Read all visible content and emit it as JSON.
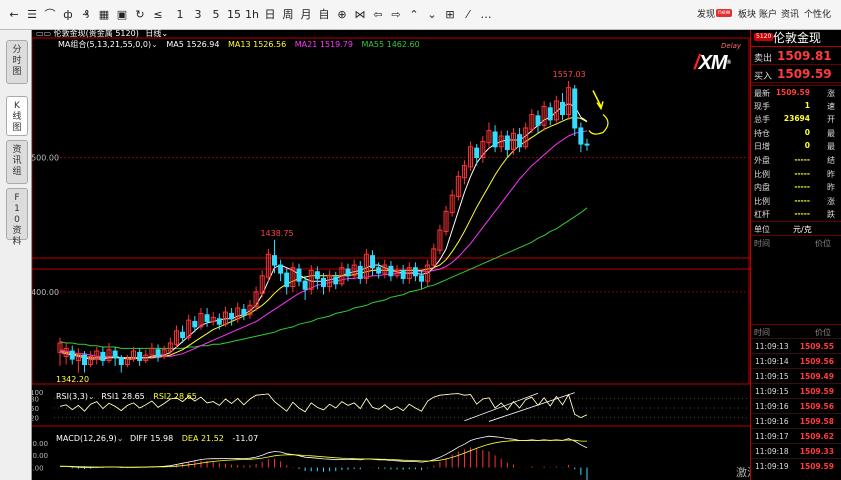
{
  "toolbar": {
    "icons": [
      {
        "name": "back-arrow-icon",
        "glyph": "←"
      },
      {
        "name": "list-icon",
        "glyph": "☰"
      },
      {
        "name": "line-chart-icon",
        "glyph": "⌒"
      },
      {
        "name": "bar-chart-icon",
        "glyph": "ф"
      },
      {
        "name": "candle-chart-icon",
        "glyph": "₰"
      },
      {
        "name": "table-icon",
        "glyph": "▦"
      },
      {
        "name": "panel-icon",
        "glyph": "▣"
      },
      {
        "name": "refresh-icon",
        "glyph": "↻"
      },
      {
        "name": "draw-line-icon",
        "glyph": "≤"
      }
    ],
    "periods": [
      "1",
      "3",
      "5",
      "15",
      "1h",
      "日",
      "周",
      "月",
      "自"
    ],
    "nav_icons": [
      {
        "name": "zoom-in-icon",
        "glyph": "⊕"
      },
      {
        "name": "zoom-fit-icon",
        "glyph": "⋈"
      },
      {
        "name": "scroll-left-icon",
        "glyph": "⇦"
      },
      {
        "name": "scroll-right-icon",
        "glyph": "⇨"
      },
      {
        "name": "expand-up-icon",
        "glyph": "⌃"
      },
      {
        "name": "collapse-down-icon",
        "glyph": "⌄"
      },
      {
        "name": "layout-icon",
        "glyph": "⊞"
      },
      {
        "name": "pen-icon",
        "glyph": "⁄"
      },
      {
        "name": "more-icon",
        "glyph": "…"
      }
    ],
    "discover": "发现",
    "new_badge": "new",
    "sector": "板块",
    "account": "账户",
    "news": "资讯",
    "personalize": "个性化"
  },
  "left_tabs": [
    "分时图",
    "K线图",
    "资讯组",
    "F10资料"
  ],
  "chart": {
    "header": {
      "title": "伦敦金现(贵金属 5120)",
      "period": "日线"
    },
    "ma_legend": {
      "label": "MA组合(5,13,21,55,0,0)",
      "ma5": "MA5 1526.94",
      "ma13": "MA13 1526.56",
      "ma21": "MA21 1519.79",
      "ma55": "MA55 1462.60"
    },
    "price_labels": {
      "high": "1557.03",
      "mid_high": "1438.75",
      "low": "1342.20",
      "grid1": "1500.00",
      "grid2": "1400.00"
    },
    "delay": "Delay",
    "rsi": {
      "label": "RSI(3,3)",
      "rsi1": "RSI1 28.65",
      "rsi2": "RSI2 28.65",
      "levels": [
        "100",
        "80",
        "50",
        "20"
      ]
    },
    "macd": {
      "label": "MACD(12,26,9)",
      "diff": "DIFF 15.98",
      "dea": "DEA 21.52",
      "macd": "-11.07",
      "levels": [
        "20.00",
        "10.00",
        "0.00"
      ]
    },
    "watermark": "激活 Windows",
    "colors": {
      "up": "#ff3333",
      "down": "#33ddff",
      "ma5": "#ffffff",
      "ma13": "#ffff33",
      "ma21": "#ff33ff",
      "ma55": "#33cc33"
    }
  },
  "chart_data": {
    "type": "candlestick",
    "title": "伦敦金现",
    "ylim": [
      1330,
      1580
    ],
    "candles": [
      [
        1355,
        1362,
        1348,
        1345,
        1366
      ],
      [
        1352,
        1358,
        1348,
        1346,
        1362
      ],
      [
        1356,
        1350,
        1346,
        1348,
        1360
      ],
      [
        1349,
        1354,
        1344,
        1340,
        1358
      ],
      [
        1353,
        1346,
        1342,
        1340,
        1356
      ],
      [
        1346,
        1352,
        1346,
        1344,
        1356
      ],
      [
        1350,
        1356,
        1350,
        1346,
        1359
      ],
      [
        1355,
        1349,
        1347,
        1345,
        1359
      ],
      [
        1349,
        1357,
        1349,
        1347,
        1362
      ],
      [
        1356,
        1351,
        1349,
        1345,
        1359
      ],
      [
        1351,
        1346,
        1343,
        1340,
        1353
      ],
      [
        1346,
        1350,
        1346,
        1344,
        1353
      ],
      [
        1350,
        1356,
        1350,
        1348,
        1359
      ],
      [
        1355,
        1349,
        1347,
        1345,
        1358
      ],
      [
        1349,
        1353,
        1349,
        1347,
        1357
      ],
      [
        1353,
        1358,
        1353,
        1350,
        1362
      ],
      [
        1357,
        1352,
        1350,
        1348,
        1361
      ],
      [
        1352,
        1357,
        1352,
        1350,
        1360
      ],
      [
        1356,
        1362,
        1356,
        1353,
        1366
      ],
      [
        1361,
        1371,
        1361,
        1358,
        1375
      ],
      [
        1370,
        1366,
        1364,
        1362,
        1375
      ],
      [
        1366,
        1379,
        1366,
        1364,
        1383
      ],
      [
        1378,
        1374,
        1372,
        1370,
        1382
      ],
      [
        1374,
        1384,
        1374,
        1372,
        1388
      ],
      [
        1383,
        1378,
        1376,
        1374,
        1388
      ],
      [
        1378,
        1381,
        1378,
        1375,
        1385
      ],
      [
        1380,
        1376,
        1374,
        1372,
        1384
      ],
      [
        1376,
        1385,
        1376,
        1374,
        1389
      ],
      [
        1384,
        1380,
        1378,
        1375,
        1388
      ],
      [
        1380,
        1388,
        1380,
        1377,
        1392
      ],
      [
        1387,
        1383,
        1381,
        1379,
        1391
      ],
      [
        1383,
        1390,
        1383,
        1380,
        1394
      ],
      [
        1389,
        1400,
        1389,
        1386,
        1404
      ],
      [
        1399,
        1412,
        1399,
        1396,
        1416
      ],
      [
        1411,
        1428,
        1411,
        1408,
        1432
      ],
      [
        1427,
        1420,
        1416,
        1414,
        1438.75
      ],
      [
        1420,
        1414,
        1412,
        1408,
        1424
      ],
      [
        1414,
        1404,
        1402,
        1398,
        1418
      ],
      [
        1404,
        1418,
        1404,
        1400,
        1422
      ],
      [
        1417,
        1408,
        1406,
        1404,
        1421
      ],
      [
        1408,
        1402,
        1396,
        1394,
        1412
      ],
      [
        1402,
        1416,
        1402,
        1398,
        1420
      ],
      [
        1415,
        1410,
        1406,
        1402,
        1419
      ],
      [
        1410,
        1404,
        1400,
        1398,
        1414
      ],
      [
        1404,
        1412,
        1404,
        1400,
        1416
      ],
      [
        1411,
        1406,
        1404,
        1402,
        1415
      ],
      [
        1406,
        1418,
        1406,
        1404,
        1422
      ],
      [
        1417,
        1412,
        1410,
        1408,
        1421
      ],
      [
        1412,
        1420,
        1412,
        1410,
        1424
      ],
      [
        1419,
        1410,
        1408,
        1406,
        1423
      ],
      [
        1410,
        1428,
        1410,
        1406,
        1432
      ],
      [
        1427,
        1418,
        1416,
        1412,
        1431
      ],
      [
        1418,
        1414,
        1412,
        1410,
        1422
      ],
      [
        1414,
        1420,
        1414,
        1410,
        1424
      ],
      [
        1419,
        1412,
        1410,
        1408,
        1423
      ],
      [
        1412,
        1416,
        1412,
        1410,
        1420
      ],
      [
        1416,
        1410,
        1408,
        1406,
        1420
      ],
      [
        1410,
        1418,
        1410,
        1406,
        1422
      ],
      [
        1418,
        1412,
        1410,
        1408,
        1422
      ],
      [
        1412,
        1408,
        1406,
        1402,
        1416
      ],
      [
        1408,
        1420,
        1408,
        1404,
        1424
      ],
      [
        1420,
        1432,
        1420,
        1418,
        1436
      ],
      [
        1431,
        1446,
        1431,
        1428,
        1450
      ],
      [
        1445,
        1460,
        1445,
        1442,
        1464
      ],
      [
        1459,
        1472,
        1459,
        1456,
        1476
      ],
      [
        1471,
        1486,
        1471,
        1468,
        1490
      ],
      [
        1485,
        1494,
        1485,
        1480,
        1498
      ],
      [
        1493,
        1508,
        1493,
        1490,
        1512
      ],
      [
        1507,
        1500,
        1496,
        1494,
        1510
      ],
      [
        1500,
        1512,
        1500,
        1496,
        1516
      ],
      [
        1511,
        1520,
        1511,
        1508,
        1526
      ],
      [
        1519,
        1508,
        1506,
        1504,
        1524
      ],
      [
        1508,
        1516,
        1508,
        1504,
        1520
      ],
      [
        1516,
        1506,
        1504,
        1500,
        1520
      ],
      [
        1506,
        1518,
        1506,
        1502,
        1522
      ],
      [
        1517,
        1508,
        1506,
        1504,
        1522
      ],
      [
        1508,
        1522,
        1508,
        1506,
        1526
      ],
      [
        1521,
        1532,
        1521,
        1518,
        1536
      ],
      [
        1531,
        1524,
        1522,
        1518,
        1535
      ],
      [
        1524,
        1538,
        1524,
        1520,
        1542
      ],
      [
        1537,
        1528,
        1526,
        1524,
        1541
      ],
      [
        1528,
        1542,
        1528,
        1526,
        1546
      ],
      [
        1541,
        1532,
        1530,
        1528,
        1548
      ],
      [
        1532,
        1552,
        1532,
        1528,
        1557.03
      ],
      [
        1551,
        1522,
        1520,
        1516,
        1554
      ],
      [
        1522,
        1510,
        1508,
        1504,
        1526
      ],
      [
        1510,
        1509.59,
        1507,
        1505,
        1514
      ]
    ],
    "ma5": [
      1355,
      1354,
      1353,
      1352,
      1351,
      1350,
      1350,
      1350,
      1351,
      1352,
      1351,
      1350,
      1350,
      1351,
      1351,
      1352,
      1353,
      1353,
      1355,
      1359,
      1363,
      1367,
      1371,
      1375,
      1377,
      1378,
      1379,
      1380,
      1380,
      1382,
      1383,
      1386,
      1390,
      1398,
      1408,
      1418,
      1420,
      1418,
      1416,
      1413,
      1410,
      1408,
      1408,
      1408,
      1409,
      1410,
      1412,
      1414,
      1415,
      1416,
      1418,
      1420,
      1420,
      1418,
      1416,
      1415,
      1414,
      1414,
      1414,
      1413,
      1414,
      1418,
      1424,
      1432,
      1446,
      1460,
      1474,
      1486,
      1496,
      1502,
      1507,
      1510,
      1512,
      1513,
      1513,
      1513,
      1516,
      1520,
      1524,
      1528,
      1530,
      1534,
      1538,
      1540,
      1538,
      1530,
      1526.94
    ],
    "ma13": [
      1356,
      1355,
      1354,
      1353,
      1352,
      1351,
      1351,
      1351,
      1351,
      1351,
      1351,
      1351,
      1351,
      1351,
      1351,
      1351,
      1352,
      1352,
      1353,
      1355,
      1357,
      1360,
      1363,
      1366,
      1369,
      1372,
      1374,
      1376,
      1378,
      1380,
      1382,
      1384,
      1387,
      1390,
      1394,
      1399,
      1403,
      1406,
      1408,
      1410,
      1411,
      1412,
      1412,
      1412,
      1412,
      1412,
      1412,
      1412,
      1413,
      1414,
      1415,
      1416,
      1416,
      1416,
      1416,
      1416,
      1416,
      1416,
      1416,
      1416,
      1417,
      1418,
      1420,
      1424,
      1430,
      1437,
      1445,
      1454,
      1463,
      1471,
      1479,
      1487,
      1494,
      1500,
      1505,
      1509,
      1512,
      1515,
      1518,
      1521,
      1523,
      1525,
      1527,
      1529,
      1530,
      1529,
      1526.56
    ],
    "ma21": [
      1357,
      1356,
      1355,
      1354,
      1354,
      1353,
      1352,
      1352,
      1352,
      1351,
      1351,
      1351,
      1351,
      1351,
      1351,
      1351,
      1351,
      1352,
      1352,
      1353,
      1354,
      1356,
      1358,
      1360,
      1362,
      1364,
      1366,
      1368,
      1370,
      1372,
      1374,
      1376,
      1378,
      1381,
      1384,
      1387,
      1390,
      1393,
      1396,
      1399,
      1401,
      1403,
      1405,
      1406,
      1407,
      1408,
      1409,
      1410,
      1410,
      1411,
      1411,
      1412,
      1412,
      1413,
      1413,
      1414,
      1414,
      1414,
      1415,
      1415,
      1415,
      1416,
      1417,
      1419,
      1422,
      1426,
      1431,
      1436,
      1442,
      1448,
      1454,
      1460,
      1466,
      1472,
      1478,
      1484,
      1489,
      1494,
      1498,
      1502,
      1506,
      1510,
      1513,
      1516,
      1518,
      1519,
      1519.79
    ],
    "ma55": [
      1363,
      1362,
      1362,
      1361,
      1361,
      1360,
      1360,
      1359,
      1359,
      1359,
      1358,
      1358,
      1358,
      1358,
      1358,
      1358,
      1358,
      1358,
      1358,
      1358,
      1358,
      1359,
      1359,
      1360,
      1360,
      1361,
      1361,
      1362,
      1363,
      1364,
      1365,
      1366,
      1367,
      1368,
      1369,
      1370,
      1372,
      1373,
      1374,
      1376,
      1377,
      1378,
      1380,
      1381,
      1382,
      1384,
      1385,
      1386,
      1388,
      1389,
      1390,
      1392,
      1393,
      1394,
      1396,
      1397,
      1398,
      1400,
      1401,
      1402,
      1404,
      1405,
      1407,
      1409,
      1411,
      1413,
      1415,
      1417,
      1419,
      1421,
      1423,
      1425,
      1427,
      1429,
      1431,
      1433,
      1435,
      1437,
      1440,
      1442,
      1445,
      1447,
      1450,
      1453,
      1456,
      1459,
      1462.6
    ],
    "rsi": [
      55,
      60,
      45,
      58,
      40,
      62,
      70,
      48,
      65,
      55,
      42,
      58,
      66,
      50,
      60,
      72,
      52,
      64,
      78,
      82,
      70,
      86,
      72,
      84,
      66,
      70,
      58,
      78,
      64,
      80,
      60,
      78,
      90,
      92,
      94,
      70,
      55,
      40,
      68,
      50,
      38,
      66,
      52,
      44,
      62,
      50,
      70,
      58,
      66,
      48,
      80,
      52,
      46,
      60,
      44,
      54,
      42,
      62,
      50,
      40,
      72,
      84,
      90,
      92,
      94,
      95,
      90,
      92,
      62,
      78,
      82,
      50,
      66,
      44,
      70,
      50,
      76,
      84,
      58,
      82,
      56,
      86,
      60,
      92,
      30,
      20,
      28.65
    ],
    "diff": [
      1,
      1,
      0.5,
      0.3,
      0,
      0,
      0.2,
      0.3,
      0.5,
      0.4,
      0.2,
      0.1,
      0.2,
      0.3,
      0.4,
      0.6,
      0.8,
      1,
      1.5,
      2.5,
      3.5,
      4.5,
      5.5,
      6.5,
      7,
      7.2,
      7.2,
      7.4,
      7.3,
      7.4,
      7.3,
      7.6,
      8.5,
      10,
      12,
      13,
      12.6,
      11.2,
      10.6,
      9.6,
      8.4,
      8,
      7.6,
      7,
      6.8,
      6.4,
      6.6,
      6.5,
      6.6,
      6.3,
      7,
      6.8,
      6.3,
      6.2,
      5.7,
      5.5,
      5.1,
      5.1,
      4.9,
      4.4,
      5,
      6.3,
      8.3,
      10.8,
      13.5,
      16.5,
      19,
      22,
      23.5,
      24.5,
      25.5,
      25,
      24.5,
      23.5,
      23,
      22,
      22,
      22.5,
      22,
      22.5,
      22,
      22.5,
      22,
      23.5,
      21.5,
      18.5,
      15.98
    ],
    "dea": [
      1,
      1,
      0.9,
      0.8,
      0.6,
      0.5,
      0.4,
      0.4,
      0.4,
      0.4,
      0.4,
      0.3,
      0.3,
      0.3,
      0.3,
      0.4,
      0.5,
      0.6,
      0.8,
      1.1,
      1.6,
      2.2,
      2.8,
      3.6,
      4.3,
      4.9,
      5.4,
      5.8,
      6.1,
      6.4,
      6.5,
      6.7,
      7.1,
      7.7,
      8.6,
      9.5,
      10.1,
      10.3,
      10.4,
      10.2,
      9.8,
      9.5,
      9.1,
      8.7,
      8.3,
      7.9,
      7.6,
      7.4,
      7.2,
      7,
      7,
      6.9,
      6.8,
      6.7,
      6.5,
      6.3,
      6,
      5.8,
      5.6,
      5.4,
      5.3,
      5.5,
      6,
      6.9,
      8.2,
      9.9,
      11.7,
      13.8,
      15.7,
      17.4,
      18.9,
      20.1,
      20.9,
      21.5,
      21.8,
      21.9,
      21.9,
      22,
      22,
      22.1,
      22.1,
      22.1,
      22.1,
      22.4,
      22.2,
      21.5,
      21.52
    ]
  },
  "right_panel": {
    "symbol_badge": "5120",
    "name": "伦敦金现",
    "sell_label": "卖出",
    "sell_value": "1509.81",
    "buy_label": "买入",
    "buy_value": "1509.59",
    "rows": [
      {
        "l": "最新",
        "v": "1509.59",
        "c": "#ff3b3b",
        "r": "涨"
      },
      {
        "l": "现手",
        "v": "1",
        "c": "#ffff33",
        "r": "速"
      },
      {
        "l": "总手",
        "v": "23694",
        "c": "#ffff33",
        "r": "开"
      },
      {
        "l": "持仓",
        "v": "0",
        "c": "#ffff33",
        "r": "最"
      },
      {
        "l": "日增",
        "v": "0",
        "c": "#ffff33",
        "r": "最"
      },
      {
        "l": "外盘",
        "v": "-----",
        "c": "#ffff33",
        "r": "结"
      },
      {
        "l": "比例",
        "v": "-----",
        "c": "#ffff33",
        "r": "昨"
      },
      {
        "l": "内盘",
        "v": "-----",
        "c": "#ffff33",
        "r": "昨"
      },
      {
        "l": "比例",
        "v": "-----",
        "c": "#ffff33",
        "r": "涨"
      },
      {
        "l": "杠杆",
        "v": "-----",
        "c": "#ffff33",
        "r": "跌"
      }
    ],
    "unit_label": "单位",
    "unit_value": "元/克",
    "time_header": "时间",
    "price_header": "价位",
    "ticks": [
      {
        "t": "11:09:13",
        "p": "1509.55"
      },
      {
        "t": "11:09:14",
        "p": "1509.56"
      },
      {
        "t": "11:09:15",
        "p": "1509.49"
      },
      {
        "t": "11:09:15",
        "p": "1509.59"
      },
      {
        "t": "11:09:16",
        "p": "1509.56"
      },
      {
        "t": "11:09:16",
        "p": "1509.58"
      },
      {
        "t": "11:09:17",
        "p": "1509.62"
      },
      {
        "t": "11:09:18",
        "p": "1509.33"
      },
      {
        "t": "11:09:19",
        "p": "1509.59"
      }
    ]
  }
}
